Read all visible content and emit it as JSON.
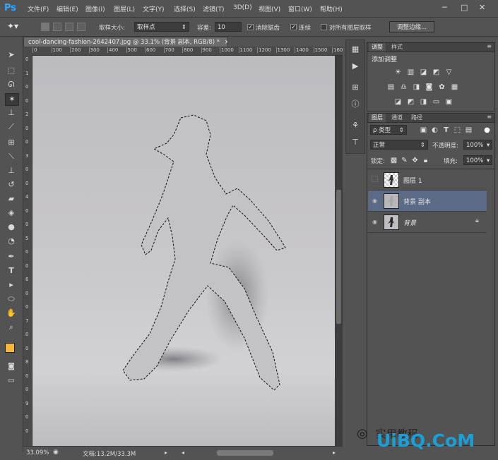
{
  "app": {
    "logo": "Ps"
  },
  "menu": [
    "文件(F)",
    "编辑(E)",
    "图像(I)",
    "图层(L)",
    "文字(Y)",
    "选择(S)",
    "滤镜(T)",
    "3D(D)",
    "视图(V)",
    "窗口(W)",
    "帮助(H)"
  ],
  "window_controls": {
    "minimize": "─",
    "restore": "□",
    "close": "✕"
  },
  "options": {
    "sample_size_label": "取样大小:",
    "sample_size_value": "取样点",
    "tolerance_label": "容差:",
    "tolerance_value": "10",
    "antialias_label": "消除锯齿",
    "contiguous_label": "连续",
    "sample_all_label": "对所有图层取样",
    "refine_edge_label": "调整边缘..."
  },
  "document": {
    "tab_title": "cool-dancing-fashion-2642407.jpg @ 33.1% (背景 副本, RGB/8) *",
    "close_glyph": "×",
    "ruler_top": [
      "0",
      "100",
      "200",
      "300",
      "400",
      "500",
      "600",
      "700",
      "800",
      "900",
      "1000",
      "1100",
      "1200",
      "1300",
      "1400",
      "1500",
      "1600"
    ],
    "ruler_left": [
      "0",
      "1",
      "0",
      "0",
      "2",
      "0",
      "0",
      "3",
      "0",
      "0",
      "4",
      "0",
      "0",
      "5",
      "0",
      "0",
      "6",
      "0",
      "0",
      "7",
      "0",
      "0",
      "8",
      "0",
      "0",
      "9",
      "0",
      "0"
    ]
  },
  "status": {
    "zoom": "33.09%",
    "doc_size": "文档:13.2M/33.3M"
  },
  "adjustments_panel": {
    "tabs": [
      "调整",
      "样式"
    ],
    "heading": "添加调整"
  },
  "layers_panel": {
    "tabs": [
      "图层",
      "通道",
      "路径"
    ],
    "filter_label": "ρ 类型",
    "blend_mode": "正常",
    "opacity_label": "不透明度:",
    "opacity_value": "100%",
    "lock_label": "锁定:",
    "fill_label": "填充:",
    "fill_value": "100%",
    "layers": [
      {
        "name": "图层 1",
        "visible": false,
        "selected": false
      },
      {
        "name": "背景 副本",
        "visible": true,
        "selected": true
      },
      {
        "name": "背景",
        "visible": true,
        "selected": false,
        "locked": true
      }
    ]
  },
  "colors": {
    "foreground": "#f4b93a",
    "background": "#ffffff",
    "accent": "#31a8ff",
    "selected_layer": "#5b6a85"
  },
  "watermark": {
    "text_left": "实用教程",
    "text_main": "UiBQ.CoM"
  }
}
